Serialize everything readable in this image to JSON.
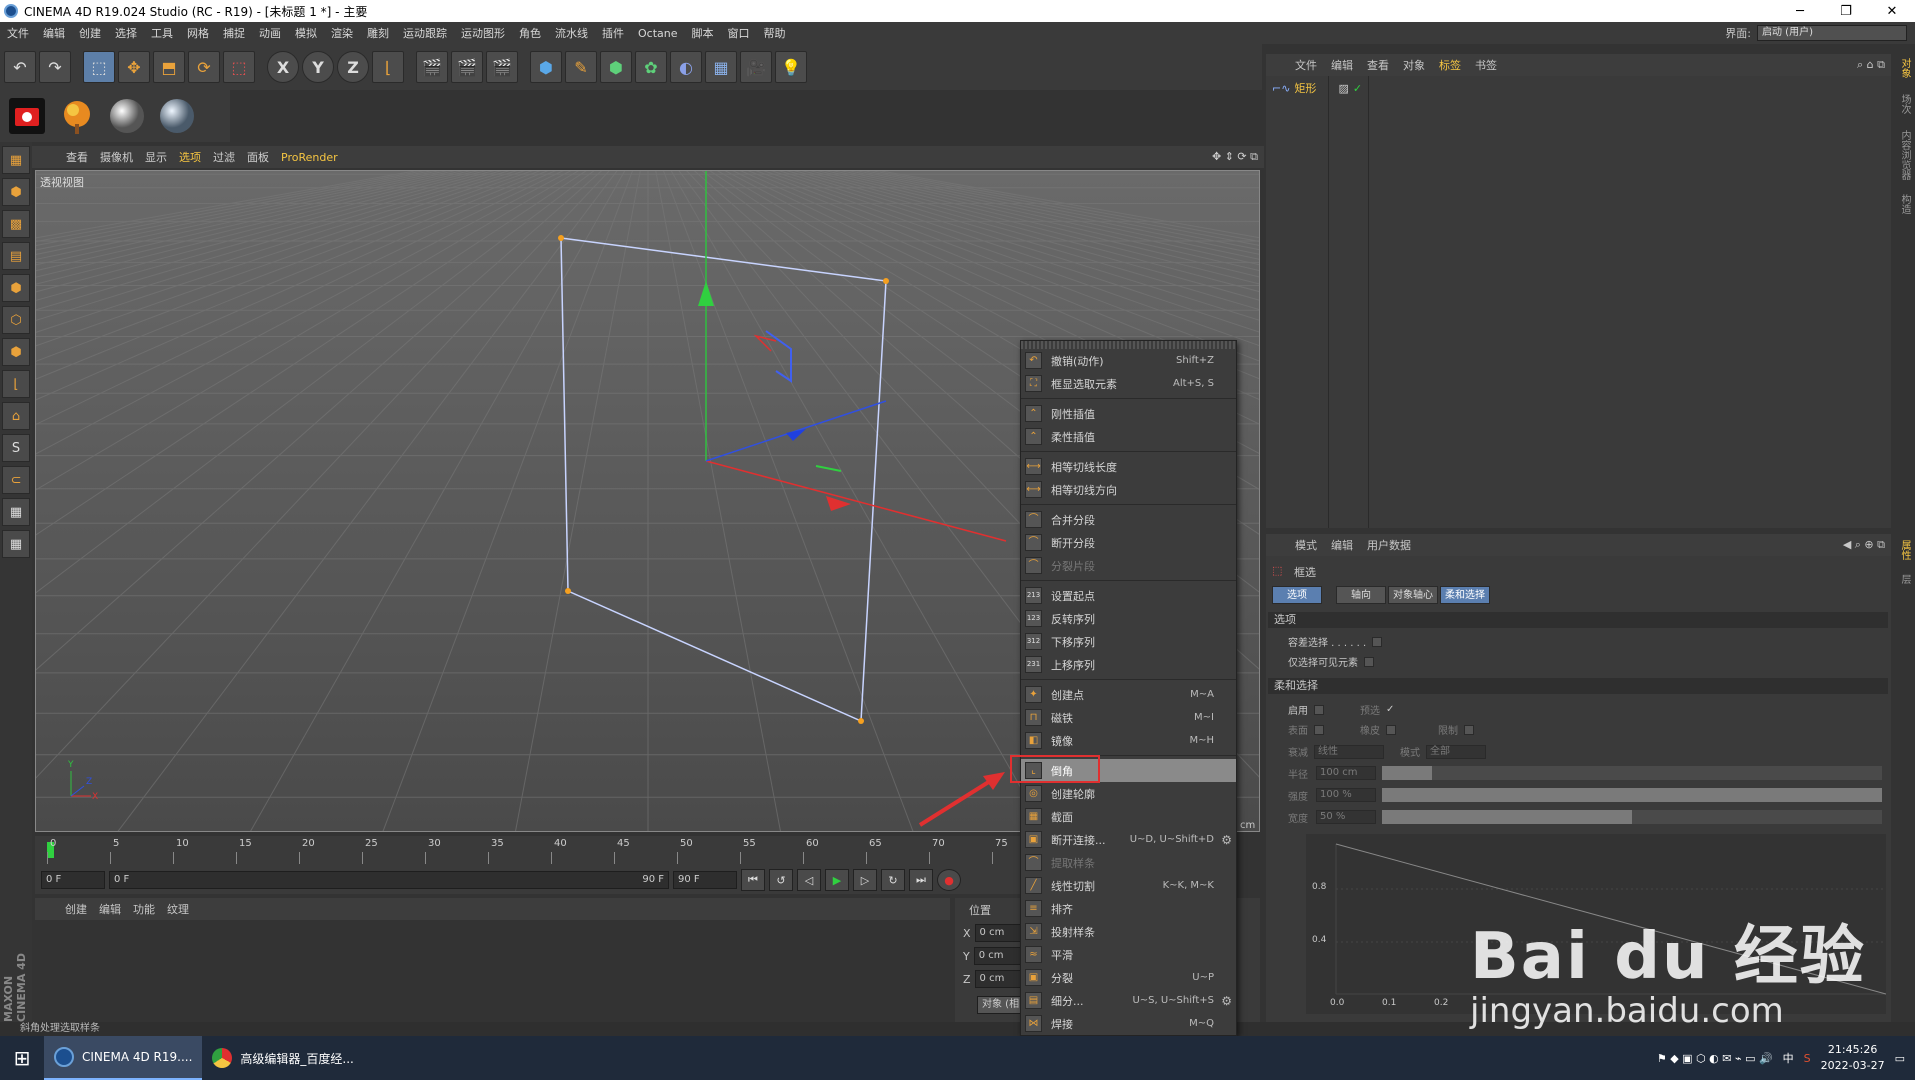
{
  "window": {
    "title": "CINEMA 4D R19.024 Studio (RC - R19) - [未标题 1 *] - 主要",
    "minimize": "─",
    "maximize": "❐",
    "close": "✕"
  },
  "menubar": {
    "items": [
      "文件",
      "编辑",
      "创建",
      "选择",
      "工具",
      "网格",
      "捕捉",
      "动画",
      "模拟",
      "渲染",
      "雕刻",
      "运动跟踪",
      "运动图形",
      "角色",
      "流水线",
      "插件",
      "Octane",
      "脚本",
      "窗口",
      "帮助"
    ],
    "layout_label": "界面:",
    "layout_value": "启动 (用户)"
  },
  "toolbar": {
    "axis_x": "X",
    "axis_y": "Y",
    "axis_z": "Z"
  },
  "viewport": {
    "menu": [
      "查看",
      "摄像机",
      "显示",
      "选项",
      "过滤",
      "面板"
    ],
    "prorender": "ProRender",
    "label": "透视视图"
  },
  "timeline": {
    "ticks": [
      "0",
      "5",
      "10",
      "15",
      "20",
      "25",
      "30",
      "35",
      "40",
      "45",
      "50",
      "55",
      "60",
      "65",
      "70",
      "75"
    ],
    "start_field": "0 F",
    "range_start": "0 F",
    "range_end": "90 F",
    "end_field": "90 F",
    "cm_label": "cm"
  },
  "material": {
    "menu": [
      "创建",
      "编辑",
      "功能",
      "纹理"
    ],
    "brand": "MAXON CINEMA 4D"
  },
  "coords": {
    "header": "位置",
    "rows": [
      {
        "axis": "X",
        "value": "0 cm"
      },
      {
        "axis": "Y",
        "value": "0 cm"
      },
      {
        "axis": "Z",
        "value": "0 cm"
      }
    ],
    "mode_button": "对象 (相"
  },
  "status": "斜角处理选取样条",
  "object_manager": {
    "menu": [
      "文件",
      "编辑",
      "查看",
      "对象",
      "标签",
      "书签"
    ],
    "active_menu": "标签",
    "object_name": "矩形"
  },
  "attributes": {
    "menu": [
      "模式",
      "编辑",
      "用户数据"
    ],
    "tool_name": "框选",
    "tabs": [
      "选项",
      "轴向",
      "对象轴心",
      "柔和选择"
    ],
    "section_options": "选项",
    "opt_tolerant": "容差选择 . . . . . .",
    "opt_visible": "仅选择可见元素",
    "section_soft": "柔和选择",
    "enable": "启用",
    "preview": "预选",
    "surface": "表面",
    "rubber": "橡皮",
    "limit": "限制",
    "falloff_label": "衰减",
    "falloff_value": "线性",
    "mode_label": "模式",
    "mode_value": "全部",
    "radius_label": "半径",
    "radius_value": "100 cm",
    "strength_label": "强度",
    "strength_value": "100 %",
    "width_label": "宽度",
    "width_value": "50 %",
    "graph_y": [
      "0.8",
      "0.4"
    ],
    "graph_x": [
      "0.0",
      "0.1",
      "0.2"
    ]
  },
  "right_tabs": [
    "对象",
    "场次",
    "内容浏览器",
    "构造",
    "属性",
    "层"
  ],
  "context_menu": [
    {
      "label": "撤销(动作)",
      "shortcut": "Shift+Z",
      "icon": "↶"
    },
    {
      "label": "框显选取元素",
      "shortcut": "Alt+S, S",
      "icon": "⛶"
    },
    {
      "sep": true
    },
    {
      "label": "刚性插值",
      "shortcut": "",
      "icon": "⌃"
    },
    {
      "label": "柔性插值",
      "shortcut": "",
      "icon": "⌃"
    },
    {
      "sep": true
    },
    {
      "label": "相等切线长度",
      "shortcut": "",
      "icon": "⟷"
    },
    {
      "label": "相等切线方向",
      "shortcut": "",
      "icon": "⟷"
    },
    {
      "sep": true
    },
    {
      "label": "合并分段",
      "shortcut": "",
      "icon": "⌒"
    },
    {
      "label": "断开分段",
      "shortcut": "",
      "icon": "⌒"
    },
    {
      "label": "分裂片段",
      "shortcut": "",
      "icon": "⌒",
      "disabled": true
    },
    {
      "sep": true
    },
    {
      "label": "设置起点",
      "shortcut": "",
      "icon": "213"
    },
    {
      "label": "反转序列",
      "shortcut": "",
      "icon": "123"
    },
    {
      "label": "下移序列",
      "shortcut": "",
      "icon": "312"
    },
    {
      "label": "上移序列",
      "shortcut": "",
      "icon": "231"
    },
    {
      "sep": true
    },
    {
      "label": "创建点",
      "shortcut": "M~A",
      "icon": "✦"
    },
    {
      "label": "磁铁",
      "shortcut": "M~I",
      "icon": "⊓"
    },
    {
      "label": "镜像",
      "shortcut": "M~H",
      "icon": "◧"
    },
    {
      "sep": true
    },
    {
      "label": "倒角",
      "shortcut": "",
      "icon": "⌞",
      "highlight": true
    },
    {
      "label": "创建轮廓",
      "shortcut": "",
      "icon": "◎"
    },
    {
      "label": "截面",
      "shortcut": "",
      "icon": "▦"
    },
    {
      "label": "断开连接...",
      "shortcut": "U~D, U~Shift+D",
      "icon": "▣",
      "gear": true
    },
    {
      "label": "提取样条",
      "shortcut": "",
      "icon": "⌒",
      "disabled": true
    },
    {
      "label": "线性切割",
      "shortcut": "K~K, M~K",
      "icon": "╱"
    },
    {
      "label": "排齐",
      "shortcut": "",
      "icon": "≡"
    },
    {
      "label": "投射样条",
      "shortcut": "",
      "icon": "⇲"
    },
    {
      "label": "平滑",
      "shortcut": "",
      "icon": "≈"
    },
    {
      "label": "分裂",
      "shortcut": "U~P",
      "icon": "▣"
    },
    {
      "label": "细分...",
      "shortcut": "U~S, U~Shift+S",
      "icon": "▤",
      "gear": true
    },
    {
      "label": "焊接",
      "shortcut": "M~Q",
      "icon": "⋈"
    }
  ],
  "taskbar": {
    "start": "⊞",
    "apps": [
      {
        "label": "CINEMA 4D R19....",
        "active": true
      },
      {
        "label": "高级编辑器_百度经...",
        "active": false
      }
    ],
    "ime": "中",
    "time": "21:45:26",
    "date": "2022-03-27"
  },
  "watermark": {
    "line1": "Bai du 经验",
    "line2": "jingyan.baidu.com"
  }
}
